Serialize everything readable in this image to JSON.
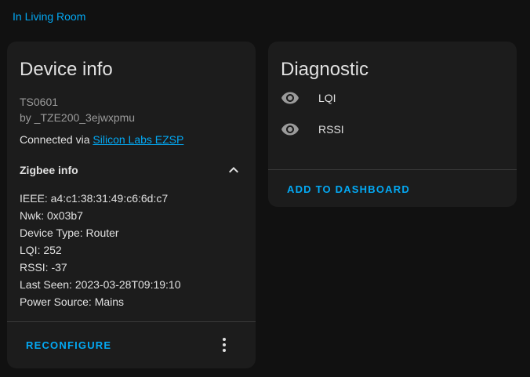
{
  "area_link": "In Living Room",
  "device_card": {
    "title": "Device info",
    "model": "TS0601",
    "manufacturer": "by _TZE200_3ejwxpmu",
    "connected_prefix": "Connected via ",
    "connected_link": "Silicon Labs EZSP",
    "zigbee_header": "Zigbee info",
    "zigbee_rows": [
      "IEEE: a4:c1:38:31:49:c6:6d:c7",
      "Nwk: 0x03b7",
      "Device Type: Router",
      "LQI: 252",
      "RSSI: -37",
      "Last Seen: 2023-03-28T09:19:10",
      "Power Source: Mains"
    ],
    "reconfigure_label": "RECONFIGURE"
  },
  "diagnostic_card": {
    "title": "Diagnostic",
    "entities": [
      {
        "icon": "eye-icon",
        "name": "LQI"
      },
      {
        "icon": "eye-icon",
        "name": "RSSI"
      }
    ],
    "add_label": "ADD TO DASHBOARD"
  },
  "colors": {
    "accent": "#03a9f4",
    "card_bg": "#1c1c1c",
    "page_bg": "#111111"
  }
}
